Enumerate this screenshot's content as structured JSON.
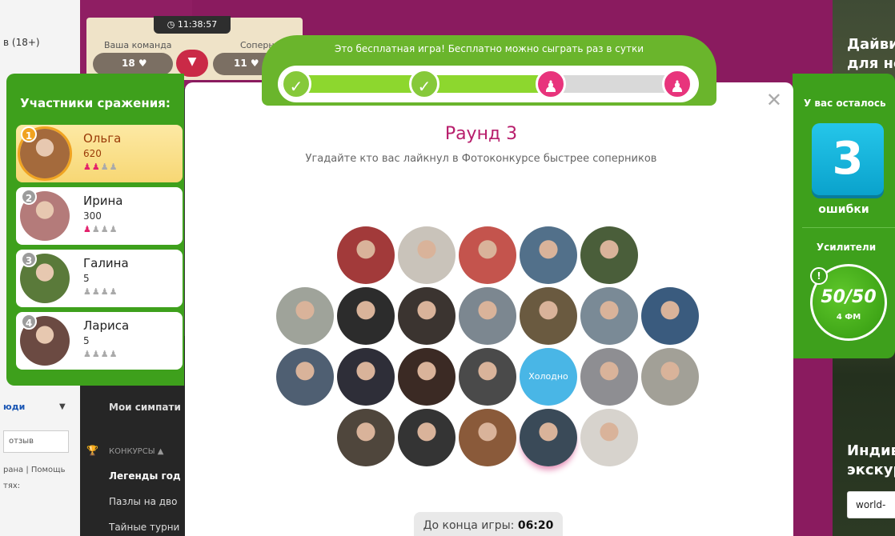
{
  "background": {
    "age_label": "в (18+)",
    "people_label": "юди",
    "review_label": "отзыв",
    "footer_1": "рана | Помощь",
    "footer_2": "тях:",
    "menu": {
      "sympathy": "Мои симпати",
      "contests": "КОНКУРСЫ ▲",
      "item_1": "Легенды год",
      "item_2": "Пазлы на дво",
      "item_3": "Тайные турни"
    },
    "ad_top": "Дайви для не",
    "ad_bottom": "Индив экскур",
    "ad_button": "world-"
  },
  "team_board": {
    "timer": "11:38:57",
    "your_team_label": "Ваша команда",
    "rivals_label": "Соперники",
    "your_score": "18",
    "rivals_score": "11"
  },
  "progress": {
    "caption": "Это бесплатная игра! Бесплатно можно сыграть раз в сутки",
    "completed_rounds": 2,
    "total_rounds": 4
  },
  "participants": {
    "title": "Участники сражения:",
    "items": [
      {
        "rank": "1",
        "name": "Ольга",
        "score": "620",
        "marks_on": 2,
        "avatar": "#a46a3c"
      },
      {
        "rank": "2",
        "name": "Ирина",
        "score": "300",
        "marks_on": 1,
        "avatar": "#b47b7a"
      },
      {
        "rank": "3",
        "name": "Галина",
        "score": "5",
        "marks_on": 0,
        "avatar": "#5a7a3a"
      },
      {
        "rank": "4",
        "name": "Лариса",
        "score": "5",
        "marks_on": 0,
        "avatar": "#6b4a42"
      }
    ]
  },
  "round": {
    "title": "Раунд 3",
    "subtitle": "Угадайте кто вас лайкнул в Фотоконкурсе быстрее соперников",
    "timer_label": "До конца игры: ",
    "timer_value": "06:20"
  },
  "photos": [
    {
      "color": "#a23a3a",
      "label": ""
    },
    {
      "color": "#c9c3ba",
      "label": ""
    },
    {
      "color": "#c4544d",
      "label": ""
    },
    {
      "color": "#52708a",
      "label": ""
    },
    {
      "color": "#4a5e3a",
      "label": ""
    },
    {
      "color": "#9fa39a",
      "label": ""
    },
    {
      "color": "#2c2c2c",
      "label": ""
    },
    {
      "color": "#3b3430",
      "label": ""
    },
    {
      "color": "#7c8790",
      "label": ""
    },
    {
      "color": "#6a5a40",
      "label": ""
    },
    {
      "color": "#7a8a96",
      "label": ""
    },
    {
      "color": "#3a5b7e",
      "label": ""
    },
    {
      "color": "#4f5f72",
      "label": ""
    },
    {
      "color": "#2e2e38",
      "label": ""
    },
    {
      "color": "#3b2a24",
      "label": ""
    },
    {
      "color": "#4a4a4a",
      "label": ""
    },
    {
      "color": "#49b6e6",
      "label": "Холодно"
    },
    {
      "color": "#8e8e92",
      "label": ""
    },
    {
      "color": "#a2a097",
      "label": ""
    },
    {
      "color": "#4f463c",
      "label": ""
    },
    {
      "color": "#343434",
      "label": ""
    },
    {
      "color": "#8a5a3a",
      "label": ""
    },
    {
      "color": "#3a4a58",
      "label": ""
    },
    {
      "color": "#d7d3cd",
      "label": ""
    }
  ],
  "right_panel": {
    "title": "У вас осталось",
    "lives": "3",
    "errors_label": "ошибки",
    "boosters_label": "Усилители",
    "booster_value": "50/50",
    "booster_cost": "4 ФМ",
    "booster_info": "!"
  },
  "colors": {
    "panel_green": "#3ea01c",
    "accent_pink": "#e8347c",
    "title_pink": "#b81e6c",
    "lives_blue": "#16b4dc"
  }
}
